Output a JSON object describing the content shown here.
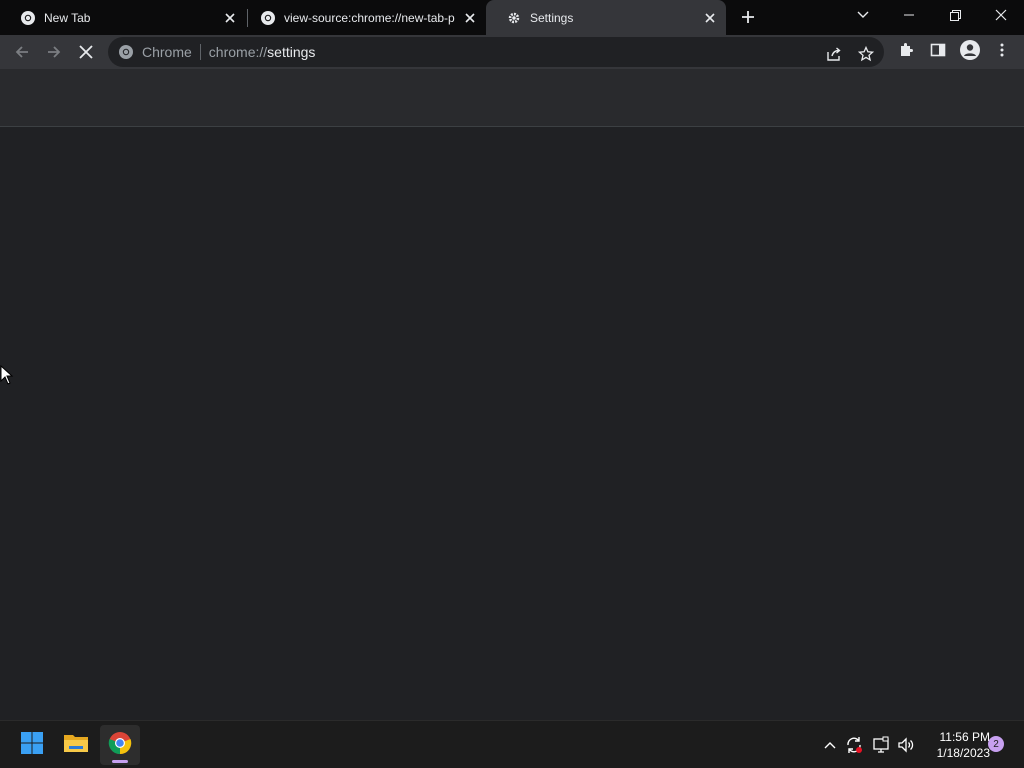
{
  "tabs": [
    {
      "title": "New Tab",
      "icon": "chrome-icon",
      "active": false
    },
    {
      "title": "view-source:chrome://new-tab-p",
      "icon": "chrome-icon",
      "active": false
    },
    {
      "title": "Settings",
      "icon": "gear-icon",
      "active": true
    }
  ],
  "omnibox": {
    "chip_label": "Chrome",
    "url_scheme": "chrome://",
    "url_host": "settings"
  },
  "taskbar": {
    "time": "11:56 PM",
    "date": "1/18/2023",
    "notification_count": "2"
  },
  "colors": {
    "accent": "#c7a0f0",
    "page_bg": "#202124",
    "toolbar_bg": "#35363a"
  }
}
